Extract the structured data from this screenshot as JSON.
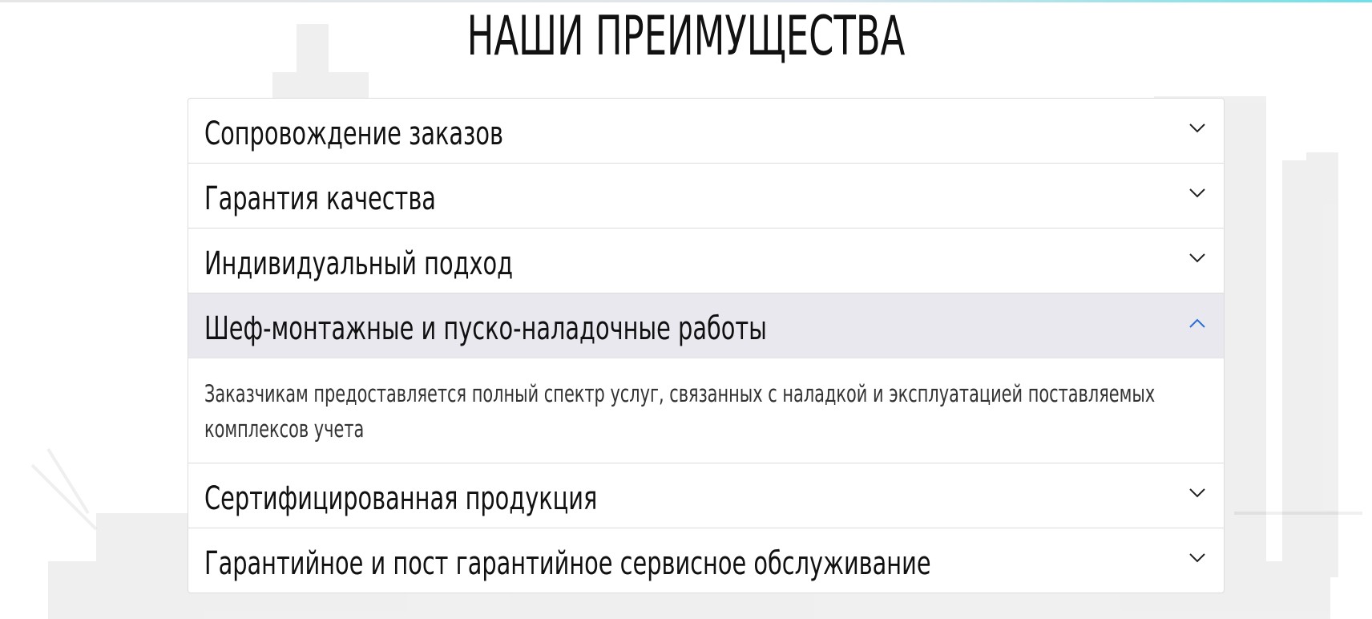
{
  "section": {
    "title": "НАШИ ПРЕИМУЩЕСТВА"
  },
  "accordion": {
    "items": [
      {
        "label": "Сопровождение заказов",
        "expanded": false
      },
      {
        "label": "Гарантия качества",
        "expanded": false
      },
      {
        "label": "Индивидуальный подход",
        "expanded": false
      },
      {
        "label": "Шеф-монтажные и пуско-наладочные работы",
        "expanded": true,
        "body": "Заказчикам предоставляется полный спектр услуг, связанных с наладкой и эксплуатацией поставляемых комплексов учета"
      },
      {
        "label": "Сертифицированная продукция",
        "expanded": false
      },
      {
        "label": "Гарантийное и пост гарантийное сервисное обслуживание",
        "expanded": false
      }
    ]
  },
  "icons": {
    "collapsed": "chevron-down-icon",
    "expanded": "chevron-up-icon"
  },
  "colors": {
    "active_header_bg": "#e8e8ee",
    "active_chevron": "#2a6fdb",
    "chevron": "#222222",
    "border": "#dcdcdc"
  }
}
